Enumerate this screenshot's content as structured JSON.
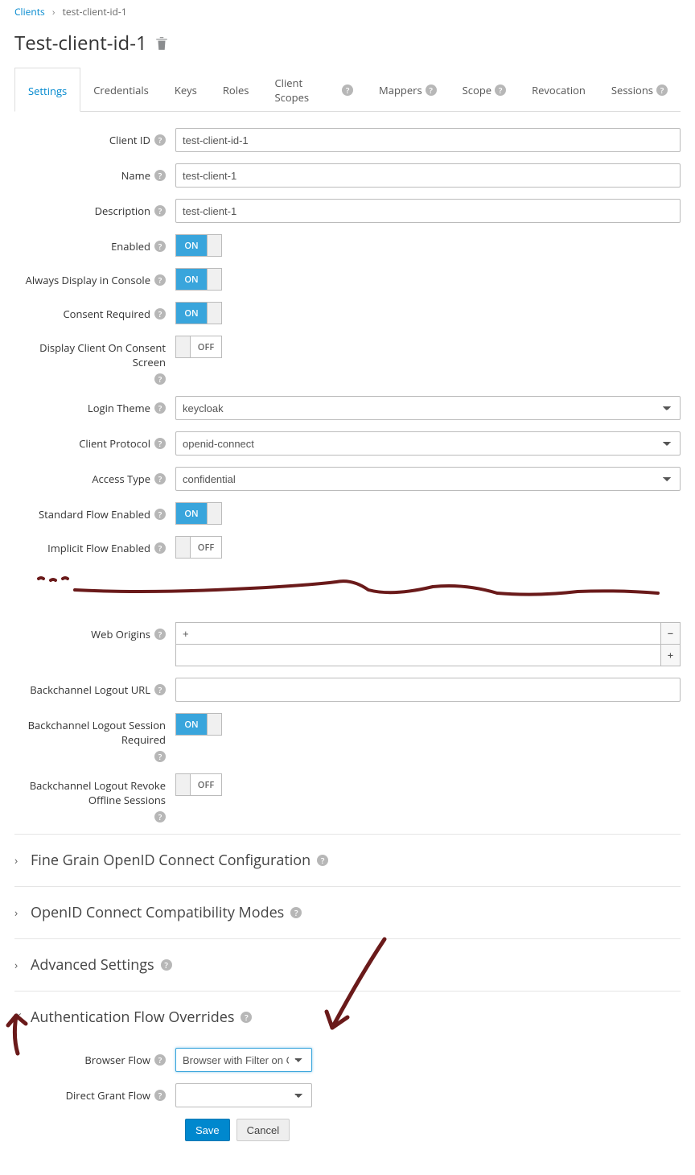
{
  "breadcrumb": {
    "root": "Clients",
    "current": "test-client-id-1"
  },
  "page_title": "Test-client-id-1",
  "tabs": [
    {
      "label": "Settings",
      "help": false,
      "active": true
    },
    {
      "label": "Credentials",
      "help": false
    },
    {
      "label": "Keys",
      "help": false
    },
    {
      "label": "Roles",
      "help": false
    },
    {
      "label": "Client Scopes",
      "help": true
    },
    {
      "label": "Mappers",
      "help": true
    },
    {
      "label": "Scope",
      "help": true
    },
    {
      "label": "Revocation",
      "help": false
    },
    {
      "label": "Sessions",
      "help": true
    }
  ],
  "fields": {
    "client_id": {
      "label": "Client ID",
      "value": "test-client-id-1"
    },
    "name": {
      "label": "Name",
      "value": "test-client-1"
    },
    "description": {
      "label": "Description",
      "value": "test-client-1"
    },
    "enabled": {
      "label": "Enabled",
      "value": "ON"
    },
    "always_display": {
      "label": "Always Display in Console",
      "value": "ON"
    },
    "consent_required": {
      "label": "Consent Required",
      "value": "ON"
    },
    "display_consent_screen": {
      "label": "Display Client On Consent Screen",
      "value": "OFF"
    },
    "login_theme": {
      "label": "Login Theme",
      "value": "keycloak"
    },
    "client_protocol": {
      "label": "Client Protocol",
      "value": "openid-connect"
    },
    "access_type": {
      "label": "Access Type",
      "value": "confidential"
    },
    "standard_flow": {
      "label": "Standard Flow Enabled",
      "value": "ON"
    },
    "implicit_flow": {
      "label": "Implicit Flow Enabled",
      "value": "OFF"
    },
    "web_origins": {
      "label": "Web Origins",
      "value": "+"
    },
    "backchannel_logout_url": {
      "label": "Backchannel Logout URL",
      "value": ""
    },
    "backchannel_session_required": {
      "label": "Backchannel Logout Session Required",
      "value": "ON"
    },
    "backchannel_revoke_offline": {
      "label": "Backchannel Logout Revoke Offline Sessions",
      "value": "OFF"
    }
  },
  "sections": {
    "fine_grain": "Fine Grain OpenID Connect Configuration",
    "compat": "OpenID Connect Compatibility Modes",
    "advanced": "Advanced Settings",
    "auth_overrides": "Authentication Flow Overrides"
  },
  "auth_overrides": {
    "browser_flow": {
      "label": "Browser Flow",
      "value": "Browser with Filter on Cli"
    },
    "direct_grant_flow": {
      "label": "Direct Grant Flow",
      "value": ""
    }
  },
  "buttons": {
    "save": "Save",
    "cancel": "Cancel"
  },
  "toggle_text": {
    "on": "ON",
    "off": "OFF"
  }
}
